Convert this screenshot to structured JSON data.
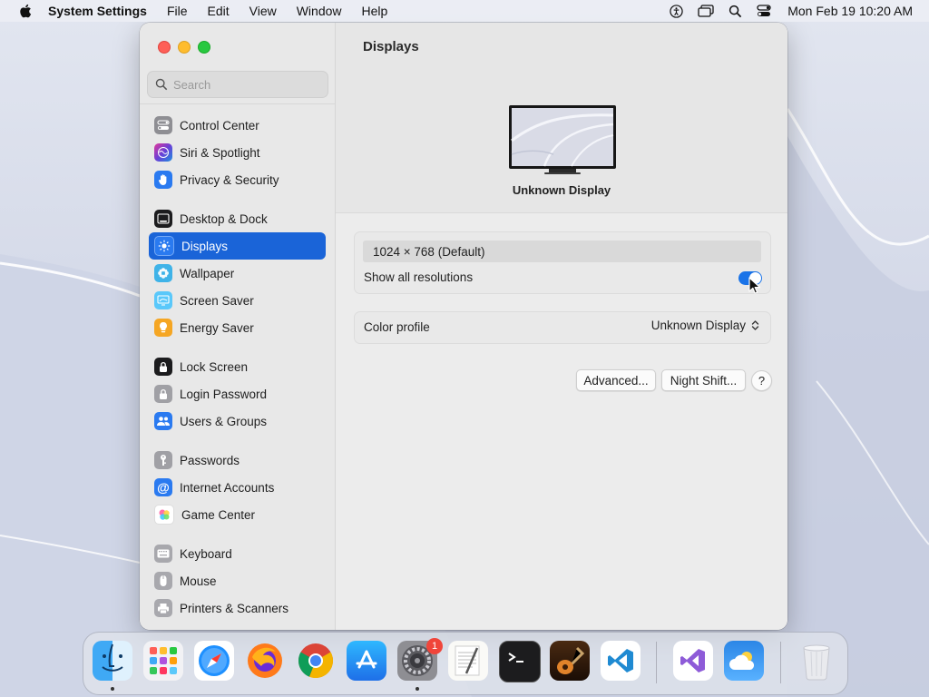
{
  "menubar": {
    "app_name": "System Settings",
    "menus": [
      "File",
      "Edit",
      "View",
      "Window",
      "Help"
    ],
    "datetime": "Mon Feb 19  10:20 AM",
    "status_icons": [
      "accessibility-icon",
      "window-switcher-icon",
      "spotlight-search-icon",
      "control-center-icon"
    ]
  },
  "sidebar": {
    "search_placeholder": "Search",
    "items": [
      {
        "label": "Control Center",
        "icon": "control-center-icon",
        "color": "#8e8e93"
      },
      {
        "label": "Siri & Spotlight",
        "icon": "siri-icon",
        "color": "#7b3fd0"
      },
      {
        "label": "Privacy & Security",
        "icon": "hand-icon",
        "color": "#2a7af0"
      },
      {
        "label": "Desktop & Dock",
        "icon": "dock-icon",
        "color": "#1c1c1e"
      },
      {
        "label": "Displays",
        "icon": "brightness-icon",
        "color": "#2a7af0",
        "selected": true
      },
      {
        "label": "Wallpaper",
        "icon": "wallpaper-icon",
        "color": "#3fb3e8"
      },
      {
        "label": "Screen Saver",
        "icon": "screen-saver-icon",
        "color": "#5ac8fa"
      },
      {
        "label": "Energy Saver",
        "icon": "lightbulb-icon",
        "color": "#f5a623"
      },
      {
        "label": "Lock Screen",
        "icon": "lock-icon",
        "color": "#1c1c1e"
      },
      {
        "label": "Login Password",
        "icon": "lock-icon",
        "color": "#8e8e93"
      },
      {
        "label": "Users & Groups",
        "icon": "users-icon",
        "color": "#2a7af0"
      },
      {
        "label": "Passwords",
        "icon": "key-icon",
        "color": "#8e8e93"
      },
      {
        "label": "Internet Accounts",
        "icon": "at-icon",
        "color": "#2a7af0"
      },
      {
        "label": "Game Center",
        "icon": "game-center-icon",
        "color": "#ffffff"
      },
      {
        "label": "Keyboard",
        "icon": "keyboard-icon",
        "color": "#a0a0a5"
      },
      {
        "label": "Mouse",
        "icon": "mouse-icon",
        "color": "#a0a0a5"
      },
      {
        "label": "Printers & Scanners",
        "icon": "printer-icon",
        "color": "#a0a0a5"
      }
    ]
  },
  "content": {
    "title": "Displays",
    "display_name": "Unknown Display",
    "resolution": "1024 × 768 (Default)",
    "show_all_resolutions_label": "Show all resolutions",
    "show_all_resolutions_on": true,
    "color_profile_label": "Color profile",
    "color_profile_value": "Unknown Display",
    "advanced_button": "Advanced...",
    "night_shift_button": "Night Shift...",
    "help_button": "?"
  },
  "dock": {
    "apps": [
      {
        "name": "Finder",
        "icon": "finder-icon",
        "running": true
      },
      {
        "name": "Launchpad",
        "icon": "launchpad-icon"
      },
      {
        "name": "Safari",
        "icon": "safari-icon"
      },
      {
        "name": "Firefox",
        "icon": "firefox-icon"
      },
      {
        "name": "Chrome",
        "icon": "chrome-icon"
      },
      {
        "name": "App Store",
        "icon": "app-store-icon"
      },
      {
        "name": "System Settings",
        "icon": "system-settings-icon",
        "running": true,
        "badge": "1"
      },
      {
        "name": "TextEdit",
        "icon": "textedit-icon"
      },
      {
        "name": "Terminal",
        "icon": "terminal-icon"
      },
      {
        "name": "GarageBand",
        "icon": "garageband-icon"
      },
      {
        "name": "Visual Studio Code",
        "icon": "vscode-icon"
      },
      {
        "name": "Visual Studio",
        "icon": "visual-studio-icon"
      },
      {
        "name": "Weather",
        "icon": "weather-icon"
      },
      {
        "name": "Trash",
        "icon": "trash-icon"
      }
    ]
  },
  "colors": {
    "accent": "#1a64d8",
    "toggle_on": "#1a73e8"
  }
}
